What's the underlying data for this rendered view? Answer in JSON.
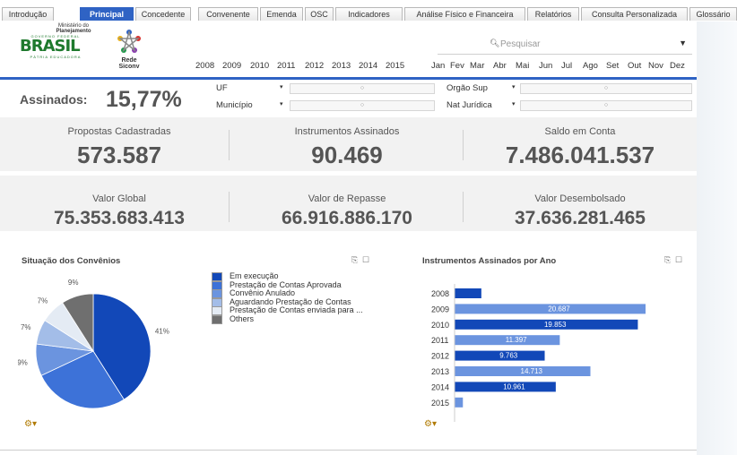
{
  "tabs": [
    "Introdução",
    "Principal",
    "Concedente",
    "Convenente",
    "Emenda",
    "OSC",
    "Indicadores",
    "Análise Físico e Financeira",
    "Relatórios",
    "Consulta Personalizada",
    "Glossário"
  ],
  "active_tab": "Principal",
  "logo": {
    "ministry_line1": "Ministério do",
    "ministry_line2": "Planejamento",
    "gov_text": "GOVERNO FEDERAL",
    "brasil": "BRASIL",
    "motto": "PÁTRIA EDUCADORA",
    "rede": "Rede Siconv"
  },
  "years": [
    "2008",
    "2009",
    "2010",
    "2011",
    "2012",
    "2013",
    "2014",
    "2015"
  ],
  "months": [
    "Jan",
    "Fev",
    "Mar",
    "Abr",
    "Mai",
    "Jun",
    "Jul",
    "Ago",
    "Set",
    "Out",
    "Nov",
    "Dez"
  ],
  "search": {
    "placeholder": "Pesquisar"
  },
  "assinados": {
    "label": "Assinados:",
    "value": "15,77%"
  },
  "filters": {
    "uf": "UF",
    "municipio": "Município",
    "orgao_sup": "Orgão Sup",
    "nat_juridica": "Nat Jurídica"
  },
  "kpis": {
    "propostas_label": "Propostas Cadastradas",
    "propostas_value": "573.587",
    "instrumentos_label": "Instrumentos Assinados",
    "instrumentos_value": "90.469",
    "saldo_label": "Saldo em Conta",
    "saldo_value": "7.486.041.537",
    "global_label": "Valor Global",
    "global_value": "75.353.683.413",
    "repasse_label": "Valor de Repasse",
    "repasse_value": "66.916.886.170",
    "desembolsado_label": "Valor Desembolsado",
    "desembolsado_value": "37.636.281.465"
  },
  "pie_panel": {
    "title": "Situação dos Convênios"
  },
  "bar_panel": {
    "title": "Instrumentos Assinados por Ano"
  },
  "chart_data": [
    {
      "type": "pie",
      "title": "Situação dos Convênios",
      "labels": [
        "Em execução",
        "Prestação de Contas Aprovada",
        "Convênio Anulado",
        "Aguardando Prestação de Contas",
        "Prestação de Contas enviada para ...",
        "Others"
      ],
      "values": [
        41,
        27,
        9,
        7,
        7,
        9
      ],
      "value_labels": [
        "41%",
        "27%",
        "9%",
        "7%",
        "7%",
        "9%"
      ],
      "colors": [
        "#1248b8",
        "#3d72d8",
        "#6b94df",
        "#a3bde8",
        "#e4ebf4",
        "#6f6f6f"
      ],
      "legend": "right"
    },
    {
      "type": "bar",
      "orientation": "horizontal",
      "title": "Instrumentos Assinados por Ano",
      "categories": [
        "2008",
        "2009",
        "2010",
        "2011",
        "2012",
        "2013",
        "2014",
        "2015"
      ],
      "values": [
        2900,
        20687,
        19853,
        11397,
        9763,
        14713,
        10961,
        900
      ],
      "value_labels": [
        "",
        "20.687",
        "19.853",
        "11.397",
        "9.763",
        "14.713",
        "10.961",
        ""
      ],
      "colors": [
        "#1248b8",
        "#6b94df",
        "#1248b8",
        "#6b94df",
        "#1248b8",
        "#6b94df",
        "#1248b8",
        "#6b94df"
      ]
    }
  ]
}
